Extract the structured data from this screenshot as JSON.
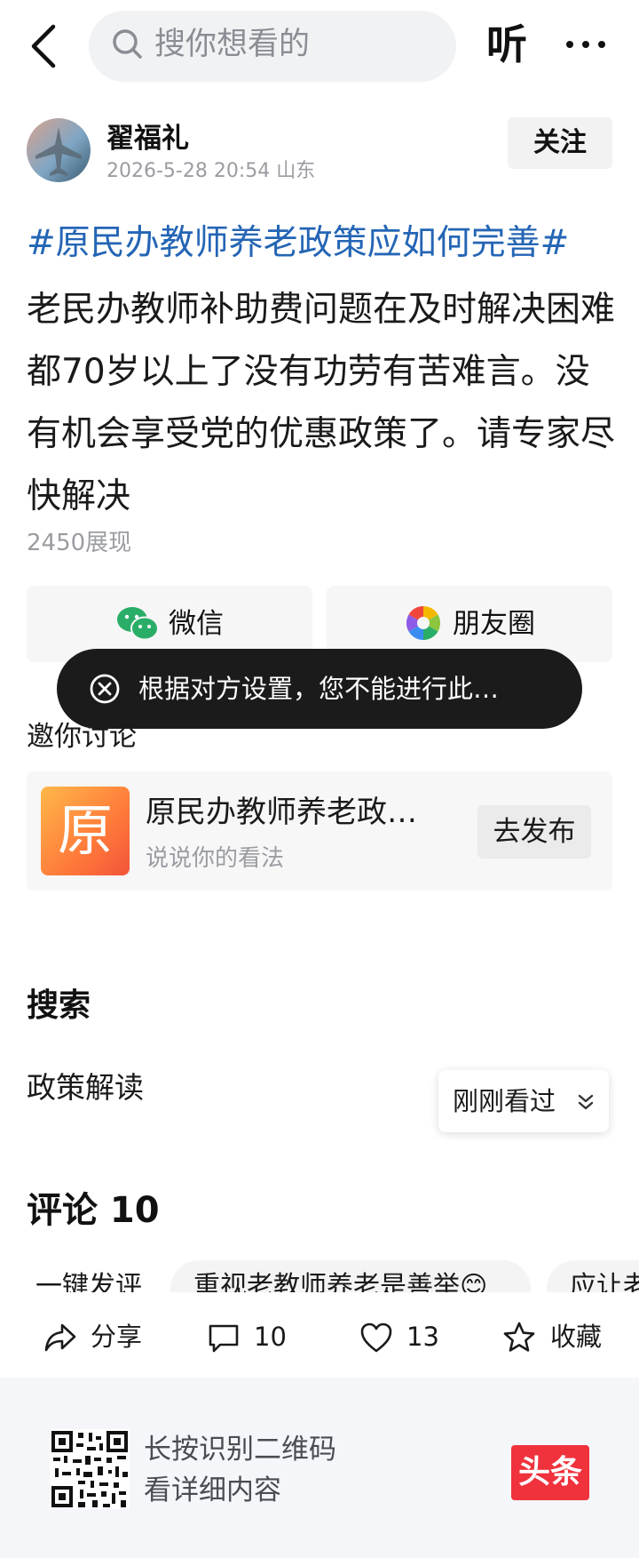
{
  "header": {
    "search_placeholder": "搜你想看的",
    "listen_label": "听"
  },
  "author": {
    "name": "翟福礼",
    "meta": "2026-5-28 20:54  山东",
    "follow_label": "关注"
  },
  "post": {
    "topic": "#原民办教师养老政策应如何完善#",
    "content": "老民办教师补助费问题在及时解决困难都70岁以上了没有功劳有苦难言。没有机会享受党的优惠政策了。请专家尽快解决",
    "views": "2450展现"
  },
  "share": {
    "wechat_label": "微信",
    "moments_label": "朋友圈"
  },
  "toast": {
    "text": "根据对方设置，您不能进行此…"
  },
  "invite": {
    "title": "邀你讨论",
    "card_thumb_char": "原",
    "card_title": "原民办教师养老政…",
    "card_subtitle": "说说你的看法",
    "publish_label": "去发布"
  },
  "search_section": {
    "title": "搜索",
    "term": "政策解读",
    "recent_label": "刚刚看过"
  },
  "comments": {
    "title": "评论 10",
    "chips": [
      "一键发评",
      "重视老教师养老是善举😊",
      "应让老"
    ]
  },
  "actions": {
    "share_label": "分享",
    "comment_count": "10",
    "like_count": "13",
    "favorite_label": "收藏"
  },
  "footer": {
    "line1": "长按识别二维码",
    "line2": "看详细内容",
    "logo_text": "头条"
  },
  "colors": {
    "topic_blue": "#2465b5",
    "toast_bg": "#1b1b1b",
    "logo_red": "#f0323c",
    "wechat_green": "#2aae67"
  }
}
